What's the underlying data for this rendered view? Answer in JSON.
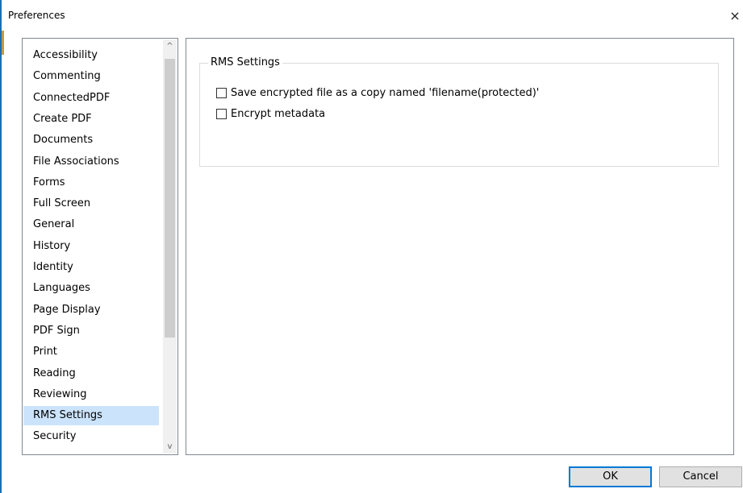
{
  "window": {
    "title": "Preferences",
    "close_glyph": "×"
  },
  "categories": {
    "items": [
      {
        "label": "Accessibility",
        "selected": false
      },
      {
        "label": "Commenting",
        "selected": false
      },
      {
        "label": "ConnectedPDF",
        "selected": false
      },
      {
        "label": "Create PDF",
        "selected": false
      },
      {
        "label": "Documents",
        "selected": false
      },
      {
        "label": "File Associations",
        "selected": false
      },
      {
        "label": "Forms",
        "selected": false
      },
      {
        "label": "Full Screen",
        "selected": false
      },
      {
        "label": "General",
        "selected": false
      },
      {
        "label": "History",
        "selected": false
      },
      {
        "label": "Identity",
        "selected": false
      },
      {
        "label": "Languages",
        "selected": false
      },
      {
        "label": "Page Display",
        "selected": false
      },
      {
        "label": "PDF Sign",
        "selected": false
      },
      {
        "label": "Print",
        "selected": false
      },
      {
        "label": "Reading",
        "selected": false
      },
      {
        "label": "Reviewing",
        "selected": false
      },
      {
        "label": "RMS Settings",
        "selected": true
      },
      {
        "label": "Security",
        "selected": false
      }
    ],
    "scroll_up_glyph": "^",
    "scroll_down_glyph": "v"
  },
  "rms_settings": {
    "group_title": "RMS Settings",
    "options": [
      {
        "label": "Save encrypted file as a copy named 'filename(protected)'",
        "checked": false
      },
      {
        "label": "Encrypt metadata",
        "checked": false
      }
    ]
  },
  "footer": {
    "ok_label": "OK",
    "cancel_label": "Cancel"
  },
  "colors": {
    "selection": "#cce4fb",
    "default_button_border": "#0078d7",
    "window_accent": "#1a6fb0"
  }
}
